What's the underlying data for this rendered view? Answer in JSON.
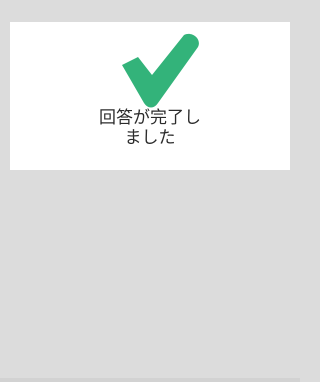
{
  "completion_card": {
    "icon": "checkmark-icon",
    "icon_color": "#33b37a",
    "message_line1": "回答が完了し",
    "message_line2": "ました"
  },
  "colors": {
    "background": "#dcdcdc",
    "card": "#ffffff",
    "text": "#2b2b2b"
  }
}
